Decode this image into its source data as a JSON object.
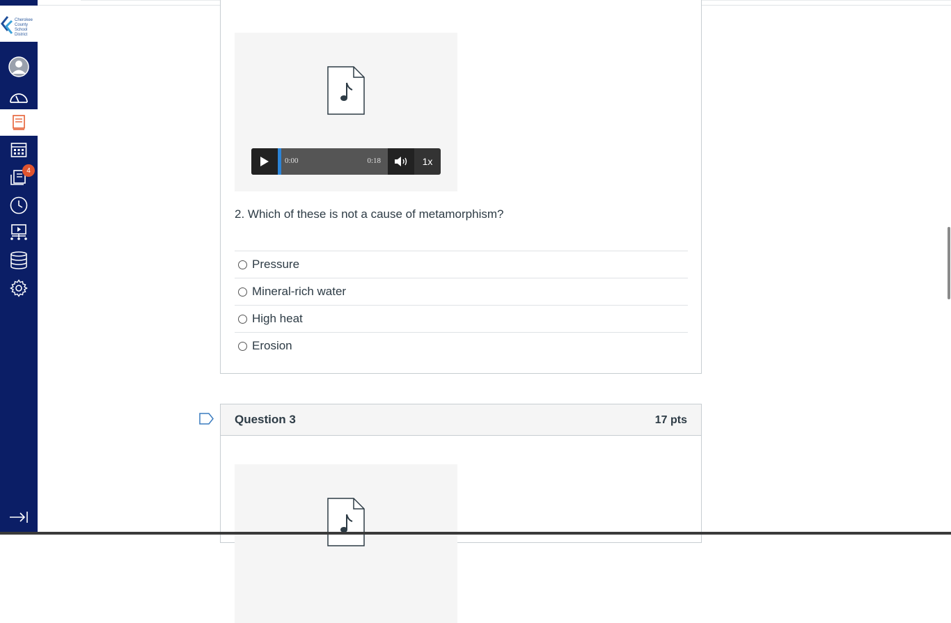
{
  "sidebar": {
    "logo_text": [
      "Cherokee",
      "County",
      "School",
      "District"
    ],
    "items": [
      {
        "name": "account",
        "icon": "user-icon"
      },
      {
        "name": "dashboard",
        "icon": "dashboard-icon"
      },
      {
        "name": "courses",
        "icon": "book-icon"
      },
      {
        "name": "calendar",
        "icon": "calendar-icon"
      },
      {
        "name": "inbox",
        "icon": "inbox-icon",
        "badge": "4"
      },
      {
        "name": "history",
        "icon": "clock-icon"
      },
      {
        "name": "studio",
        "icon": "studio-icon"
      },
      {
        "name": "commons",
        "icon": "database-icon"
      },
      {
        "name": "settings",
        "icon": "gear-icon"
      }
    ],
    "collapse_icon": "collapse-icon"
  },
  "question2": {
    "audio": {
      "current_time": "0:00",
      "duration": "0:18",
      "speed": "1x",
      "progress": 0.0
    },
    "text": "2. Which of these is not a cause of metamorphism?",
    "answers": [
      "Pressure",
      "Mineral-rich water",
      "High heat",
      "Erosion"
    ]
  },
  "question3": {
    "title": "Question 3",
    "points": "17 pts"
  },
  "colors": {
    "nav_bg": "#0b1e66",
    "badge": "#e0542f",
    "player_progress": "#2b84d8"
  }
}
